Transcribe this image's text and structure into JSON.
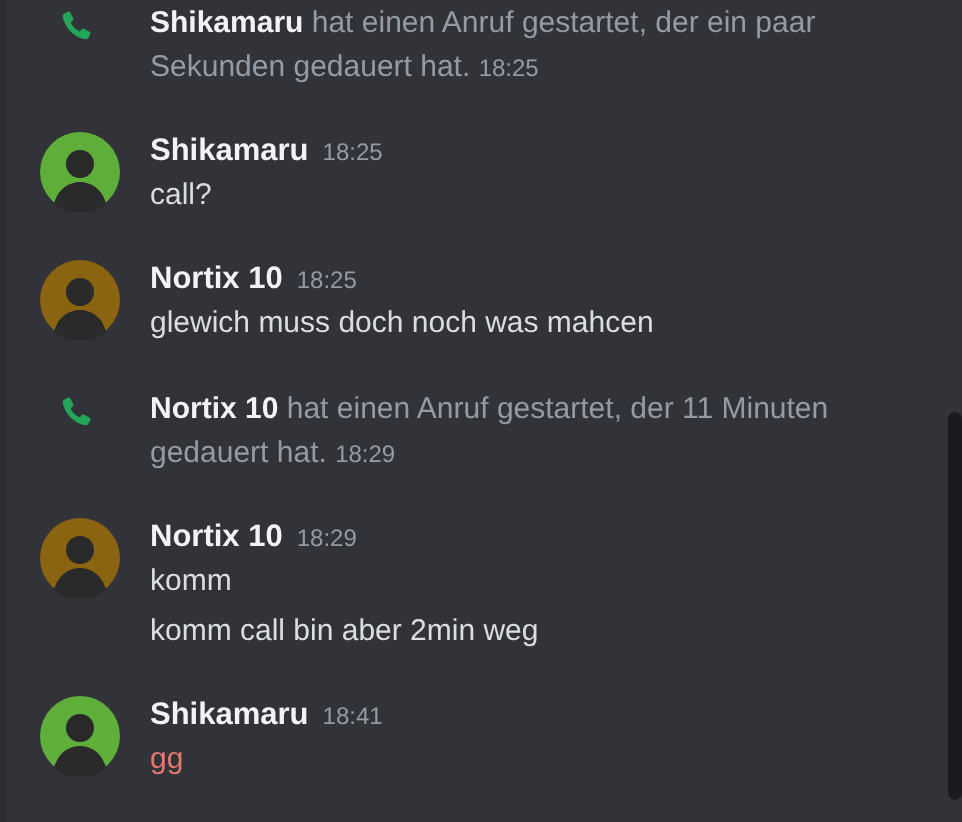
{
  "messages": [
    {
      "kind": "call",
      "text": "**Shikamaru** hat einen Anruf gestartet, der ein paar Sekunden gedauert hat.",
      "time": "18:25"
    },
    {
      "kind": "group",
      "author": "Shikamaru",
      "time": "18:25",
      "color": "#5fae3a",
      "lines": [
        {
          "text": "call?",
          "failed": false
        }
      ]
    },
    {
      "kind": "group",
      "author": "Nortix 10",
      "time": "18:25",
      "color": "#8a6410",
      "lines": [
        {
          "text": "glewich muss doch noch was mahcen",
          "failed": false
        }
      ]
    },
    {
      "kind": "call",
      "text": "**Nortix 10** hat einen Anruf gestartet, der 11 Minuten gedauert hat.",
      "time": "18:29"
    },
    {
      "kind": "group",
      "author": "Nortix 10",
      "time": "18:29",
      "color": "#8a6410",
      "lines": [
        {
          "text": "komm",
          "failed": false
        },
        {
          "text": "komm call bin aber 2min weg",
          "failed": false
        }
      ]
    },
    {
      "kind": "group",
      "author": "Shikamaru",
      "time": "18:41",
      "color": "#5fae3a",
      "lines": [
        {
          "text": "gg",
          "failed": true
        }
      ]
    }
  ]
}
